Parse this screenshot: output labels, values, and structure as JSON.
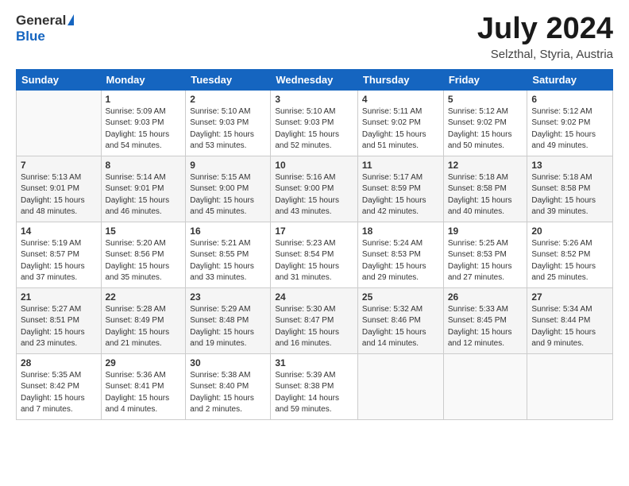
{
  "header": {
    "logo_general": "General",
    "logo_blue": "Blue",
    "title": "July 2024",
    "subtitle": "Selzthal, Styria, Austria"
  },
  "calendar": {
    "headers": [
      "Sunday",
      "Monday",
      "Tuesday",
      "Wednesday",
      "Thursday",
      "Friday",
      "Saturday"
    ],
    "rows": [
      [
        {
          "day": "",
          "info": ""
        },
        {
          "day": "1",
          "info": "Sunrise: 5:09 AM\nSunset: 9:03 PM\nDaylight: 15 hours\nand 54 minutes."
        },
        {
          "day": "2",
          "info": "Sunrise: 5:10 AM\nSunset: 9:03 PM\nDaylight: 15 hours\nand 53 minutes."
        },
        {
          "day": "3",
          "info": "Sunrise: 5:10 AM\nSunset: 9:03 PM\nDaylight: 15 hours\nand 52 minutes."
        },
        {
          "day": "4",
          "info": "Sunrise: 5:11 AM\nSunset: 9:02 PM\nDaylight: 15 hours\nand 51 minutes."
        },
        {
          "day": "5",
          "info": "Sunrise: 5:12 AM\nSunset: 9:02 PM\nDaylight: 15 hours\nand 50 minutes."
        },
        {
          "day": "6",
          "info": "Sunrise: 5:12 AM\nSunset: 9:02 PM\nDaylight: 15 hours\nand 49 minutes."
        }
      ],
      [
        {
          "day": "7",
          "info": "Sunrise: 5:13 AM\nSunset: 9:01 PM\nDaylight: 15 hours\nand 48 minutes."
        },
        {
          "day": "8",
          "info": "Sunrise: 5:14 AM\nSunset: 9:01 PM\nDaylight: 15 hours\nand 46 minutes."
        },
        {
          "day": "9",
          "info": "Sunrise: 5:15 AM\nSunset: 9:00 PM\nDaylight: 15 hours\nand 45 minutes."
        },
        {
          "day": "10",
          "info": "Sunrise: 5:16 AM\nSunset: 9:00 PM\nDaylight: 15 hours\nand 43 minutes."
        },
        {
          "day": "11",
          "info": "Sunrise: 5:17 AM\nSunset: 8:59 PM\nDaylight: 15 hours\nand 42 minutes."
        },
        {
          "day": "12",
          "info": "Sunrise: 5:18 AM\nSunset: 8:58 PM\nDaylight: 15 hours\nand 40 minutes."
        },
        {
          "day": "13",
          "info": "Sunrise: 5:18 AM\nSunset: 8:58 PM\nDaylight: 15 hours\nand 39 minutes."
        }
      ],
      [
        {
          "day": "14",
          "info": "Sunrise: 5:19 AM\nSunset: 8:57 PM\nDaylight: 15 hours\nand 37 minutes."
        },
        {
          "day": "15",
          "info": "Sunrise: 5:20 AM\nSunset: 8:56 PM\nDaylight: 15 hours\nand 35 minutes."
        },
        {
          "day": "16",
          "info": "Sunrise: 5:21 AM\nSunset: 8:55 PM\nDaylight: 15 hours\nand 33 minutes."
        },
        {
          "day": "17",
          "info": "Sunrise: 5:23 AM\nSunset: 8:54 PM\nDaylight: 15 hours\nand 31 minutes."
        },
        {
          "day": "18",
          "info": "Sunrise: 5:24 AM\nSunset: 8:53 PM\nDaylight: 15 hours\nand 29 minutes."
        },
        {
          "day": "19",
          "info": "Sunrise: 5:25 AM\nSunset: 8:53 PM\nDaylight: 15 hours\nand 27 minutes."
        },
        {
          "day": "20",
          "info": "Sunrise: 5:26 AM\nSunset: 8:52 PM\nDaylight: 15 hours\nand 25 minutes."
        }
      ],
      [
        {
          "day": "21",
          "info": "Sunrise: 5:27 AM\nSunset: 8:51 PM\nDaylight: 15 hours\nand 23 minutes."
        },
        {
          "day": "22",
          "info": "Sunrise: 5:28 AM\nSunset: 8:49 PM\nDaylight: 15 hours\nand 21 minutes."
        },
        {
          "day": "23",
          "info": "Sunrise: 5:29 AM\nSunset: 8:48 PM\nDaylight: 15 hours\nand 19 minutes."
        },
        {
          "day": "24",
          "info": "Sunrise: 5:30 AM\nSunset: 8:47 PM\nDaylight: 15 hours\nand 16 minutes."
        },
        {
          "day": "25",
          "info": "Sunrise: 5:32 AM\nSunset: 8:46 PM\nDaylight: 15 hours\nand 14 minutes."
        },
        {
          "day": "26",
          "info": "Sunrise: 5:33 AM\nSunset: 8:45 PM\nDaylight: 15 hours\nand 12 minutes."
        },
        {
          "day": "27",
          "info": "Sunrise: 5:34 AM\nSunset: 8:44 PM\nDaylight: 15 hours\nand 9 minutes."
        }
      ],
      [
        {
          "day": "28",
          "info": "Sunrise: 5:35 AM\nSunset: 8:42 PM\nDaylight: 15 hours\nand 7 minutes."
        },
        {
          "day": "29",
          "info": "Sunrise: 5:36 AM\nSunset: 8:41 PM\nDaylight: 15 hours\nand 4 minutes."
        },
        {
          "day": "30",
          "info": "Sunrise: 5:38 AM\nSunset: 8:40 PM\nDaylight: 15 hours\nand 2 minutes."
        },
        {
          "day": "31",
          "info": "Sunrise: 5:39 AM\nSunset: 8:38 PM\nDaylight: 14 hours\nand 59 minutes."
        },
        {
          "day": "",
          "info": ""
        },
        {
          "day": "",
          "info": ""
        },
        {
          "day": "",
          "info": ""
        }
      ]
    ]
  }
}
